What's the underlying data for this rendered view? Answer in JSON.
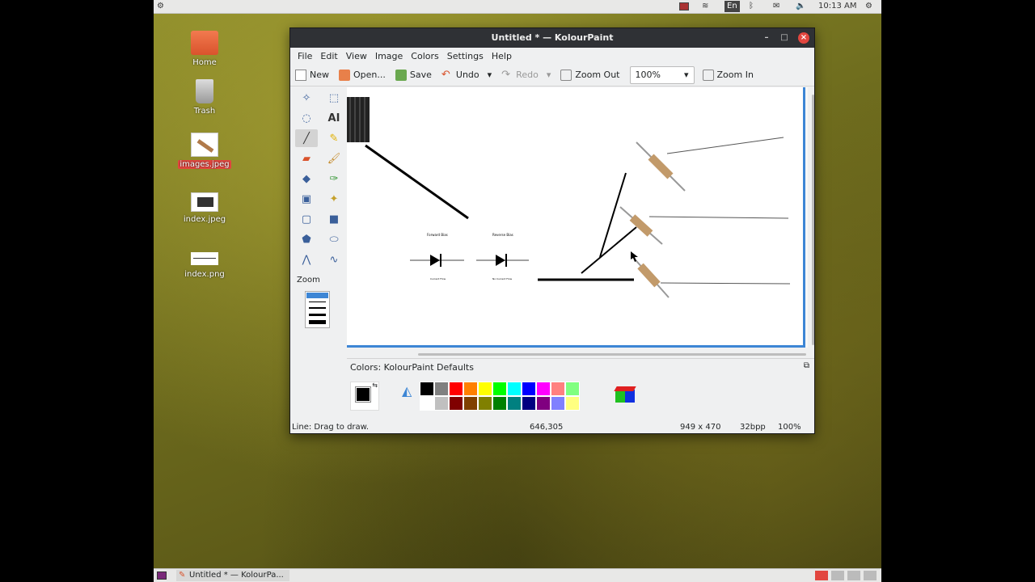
{
  "topbar": {
    "lang": "En",
    "time": "10:13 AM"
  },
  "desktop": {
    "icons": [
      {
        "label": "Home"
      },
      {
        "label": "Trash"
      },
      {
        "label": "images.jpeg"
      },
      {
        "label": "index.jpeg"
      },
      {
        "label": "index.png"
      }
    ]
  },
  "window": {
    "title": "Untitled * — KolourPaint",
    "menu": [
      "File",
      "Edit",
      "View",
      "Image",
      "Colors",
      "Settings",
      "Help"
    ],
    "toolbar": {
      "new": "New",
      "open": "Open...",
      "save": "Save",
      "undo": "Undo",
      "redo": "Redo",
      "zoom_out": "Zoom Out",
      "zoom_value": "100%",
      "zoom_in": "Zoom In"
    },
    "tools_label": "Zoom",
    "colors_title": "Colors: KolourPaint Defaults",
    "palette_row1": [
      "#000000",
      "#808080",
      "#ff0000",
      "#ff8000",
      "#ffff00",
      "#00ff00",
      "#00ffff",
      "#0000ff",
      "#ff00ff",
      "#ff8080",
      "#80ff80"
    ],
    "palette_row2": [
      "#ffffff",
      "#c0c0c0",
      "#800000",
      "#804000",
      "#808000",
      "#008000",
      "#008080",
      "#000080",
      "#800080",
      "#8080ff",
      "#ffff80"
    ],
    "status": {
      "hint": "Line: Drag to draw.",
      "coords": "646,305",
      "size": "949 x 470",
      "depth": "32bpp",
      "zoom": "100%"
    },
    "diagram": {
      "forward": "Forward Bias",
      "reverse": "Reverse Bias",
      "current_flow": "Current Flow",
      "no_current": "No Current Flow"
    }
  },
  "taskbar": {
    "task": "Untitled * — KolourPa..."
  }
}
